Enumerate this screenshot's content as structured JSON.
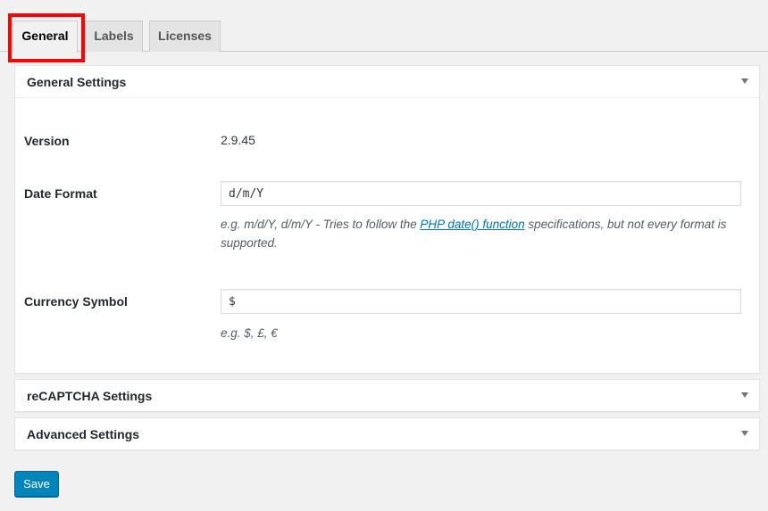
{
  "tabs": [
    {
      "label": "General",
      "active": true
    },
    {
      "label": "Labels",
      "active": false
    },
    {
      "label": "Licenses",
      "active": false
    }
  ],
  "general_settings": {
    "title": "General Settings",
    "version": {
      "label": "Version",
      "value": "2.9.45"
    },
    "date_format": {
      "label": "Date Format",
      "value": "d/m/Y",
      "desc_prefix": "e.g. m/d/Y, d/m/Y - Tries to follow the ",
      "desc_link": "PHP date() function",
      "desc_suffix": " specifications, but not every format is supported."
    },
    "currency_symbol": {
      "label": "Currency Symbol",
      "value": "$",
      "desc": "e.g. $, £, €"
    }
  },
  "recaptcha_settings": {
    "title": "reCAPTCHA Settings"
  },
  "advanced_settings": {
    "title": "Advanced Settings"
  },
  "save_label": "Save",
  "colors": {
    "highlight": "#ff0000",
    "primary_button": "#0085ba",
    "link": "#0073aa"
  },
  "icons": {
    "panel_toggle": "triangle-down-icon"
  }
}
